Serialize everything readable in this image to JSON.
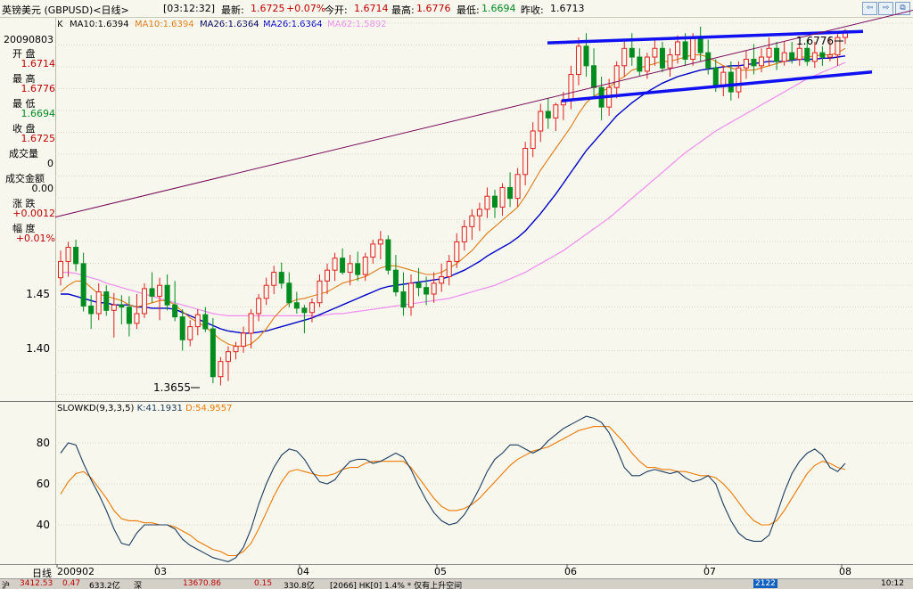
{
  "header": {
    "title": "英镑美元 (GBPUSD)<日线>",
    "time": "[03:12:32]",
    "latest_label": "最新:",
    "latest": "1.6725",
    "change": "+0.07%",
    "open_label": "今开:",
    "open": "1.6714",
    "high_label": "最高:",
    "high": "1.6776",
    "low_label": "最低:",
    "low": "1.6694",
    "prev_label": "昨收:",
    "prev": "1.6713",
    "buttons": [
      "⇦",
      "⇨",
      "⧉"
    ]
  },
  "ma_legend": {
    "k": "K",
    "ma10a": "MA10:1.6394",
    "ma10b": "MA10:1.6394",
    "ma26a": "MA26:1.6364",
    "ma26b": "MA26:1.6364",
    "ma62": "MA62:1.5892"
  },
  "sidepanel": {
    "date": "20090803",
    "open_label": "开  盘",
    "open": "1.6714",
    "high_label": "最  高",
    "high": "1.6776",
    "low_label": "最  低",
    "low": "1.6694",
    "close_label": "收  盘",
    "close": "1.6725",
    "vol_label": "成交量",
    "vol": "0",
    "amount_label": "成交金额",
    "amount": "0.00",
    "chg_label": "涨  跌",
    "chg": "+0.0012",
    "pct_label": "幅  度",
    "pct": "+0.01%"
  },
  "oscillator": {
    "name": "SLOWKD(9,3,3,5)",
    "k": "K:41.1931",
    "d": "D:54.9557"
  },
  "xaxis": {
    "period_label": "日线",
    "labels": [
      "200902",
      "03",
      "04",
      "05",
      "06",
      "07",
      "08"
    ]
  },
  "annotations": {
    "max": "1.6776",
    "min": "1.3655"
  },
  "status": {
    "s1": "沪",
    "v1": "3412.53",
    "c1": "0.47",
    "a1": "633.2亿",
    "s2": "深",
    "v2": "13670.86",
    "c2": "0.15",
    "a2": "330.8亿",
    "msg": "[2066] HK[0] 1.4% * 仅有上升空间",
    "right": "2122",
    "time": "10:12"
  },
  "chart_data": {
    "type": "candlestick",
    "price_axis": {
      "ticks": [
        1.4,
        1.45
      ],
      "labels_shown": [
        "1.40",
        "1.45"
      ]
    },
    "osc_axis": {
      "ticks": [
        40,
        60,
        80
      ],
      "ylim": [
        20,
        95
      ]
    },
    "series_labels": [
      "K",
      "MA10",
      "MA26",
      "MA62"
    ],
    "colors": {
      "up": "#E0201E",
      "down": "#008C1E",
      "ma10": "#E07A10",
      "ma26": "#0000C8",
      "ma62": "#F08CF0",
      "trend": "#1010F0",
      "resistance": "#7A0A5A",
      "k": "#1C3C60",
      "d": "#F07800"
    },
    "ohlc": [
      [
        1.465,
        1.49,
        1.458,
        1.48
      ],
      [
        1.48,
        1.498,
        1.466,
        1.493
      ],
      [
        1.493,
        1.5,
        1.471,
        1.478
      ],
      [
        1.478,
        1.488,
        1.434,
        1.439
      ],
      [
        1.439,
        1.449,
        1.418,
        1.432
      ],
      [
        1.432,
        1.46,
        1.426,
        1.452
      ],
      [
        1.452,
        1.458,
        1.43,
        1.435
      ],
      [
        1.435,
        1.451,
        1.41,
        1.44
      ],
      [
        1.44,
        1.449,
        1.422,
        1.438
      ],
      [
        1.438,
        1.448,
        1.411,
        1.423
      ],
      [
        1.423,
        1.45,
        1.418,
        1.432
      ],
      [
        1.432,
        1.46,
        1.428,
        1.455
      ],
      [
        1.455,
        1.47,
        1.442,
        1.448
      ],
      [
        1.448,
        1.465,
        1.426,
        1.458
      ],
      [
        1.458,
        1.468,
        1.435,
        1.44
      ],
      [
        1.44,
        1.462,
        1.425,
        1.429
      ],
      [
        1.429,
        1.436,
        1.398,
        1.408
      ],
      [
        1.408,
        1.426,
        1.402,
        1.42
      ],
      [
        1.42,
        1.436,
        1.412,
        1.431
      ],
      [
        1.431,
        1.438,
        1.415,
        1.418
      ],
      [
        1.418,
        1.428,
        1.368,
        1.374
      ],
      [
        1.374,
        1.392,
        1.366,
        1.388
      ],
      [
        1.388,
        1.402,
        1.37,
        1.397
      ],
      [
        1.397,
        1.406,
        1.39,
        1.402
      ],
      [
        1.402,
        1.42,
        1.396,
        1.414
      ],
      [
        1.414,
        1.436,
        1.4,
        1.432
      ],
      [
        1.432,
        1.45,
        1.425,
        1.446
      ],
      [
        1.446,
        1.465,
        1.44,
        1.458
      ],
      [
        1.458,
        1.476,
        1.45,
        1.47
      ],
      [
        1.47,
        1.479,
        1.455,
        1.46
      ],
      [
        1.46,
        1.47,
        1.438,
        1.442
      ],
      [
        1.442,
        1.452,
        1.432,
        1.437
      ],
      [
        1.437,
        1.44,
        1.414,
        1.433
      ],
      [
        1.433,
        1.446,
        1.424,
        1.442
      ],
      [
        1.442,
        1.468,
        1.438,
        1.462
      ],
      [
        1.462,
        1.478,
        1.45,
        1.472
      ],
      [
        1.472,
        1.488,
        1.462,
        1.483
      ],
      [
        1.483,
        1.492,
        1.468,
        1.47
      ],
      [
        1.47,
        1.486,
        1.458,
        1.478
      ],
      [
        1.478,
        1.489,
        1.462,
        1.468
      ],
      [
        1.468,
        1.488,
        1.462,
        1.484
      ],
      [
        1.484,
        1.5,
        1.478,
        1.496
      ],
      [
        1.496,
        1.508,
        1.482,
        1.5
      ],
      [
        1.5,
        1.504,
        1.468,
        1.472
      ],
      [
        1.472,
        1.486,
        1.448,
        1.452
      ],
      [
        1.452,
        1.47,
        1.43,
        1.438
      ],
      [
        1.438,
        1.468,
        1.43,
        1.46
      ],
      [
        1.46,
        1.474,
        1.448,
        1.456
      ],
      [
        1.456,
        1.466,
        1.44,
        1.45
      ],
      [
        1.45,
        1.47,
        1.442,
        1.46
      ],
      [
        1.46,
        1.478,
        1.452,
        1.466
      ],
      [
        1.466,
        1.486,
        1.458,
        1.48
      ],
      [
        1.48,
        1.506,
        1.474,
        1.498
      ],
      [
        1.498,
        1.518,
        1.49,
        1.512
      ],
      [
        1.512,
        1.528,
        1.5,
        1.522
      ],
      [
        1.522,
        1.534,
        1.508,
        1.528
      ],
      [
        1.528,
        1.548,
        1.52,
        1.54
      ],
      [
        1.54,
        1.546,
        1.52,
        1.53
      ],
      [
        1.53,
        1.552,
        1.522,
        1.548
      ],
      [
        1.548,
        1.562,
        1.53,
        1.538
      ],
      [
        1.538,
        1.566,
        1.53,
        1.56
      ],
      [
        1.56,
        1.59,
        1.55,
        1.584
      ],
      [
        1.584,
        1.608,
        1.576,
        1.6
      ],
      [
        1.6,
        1.625,
        1.59,
        1.618
      ],
      [
        1.618,
        1.63,
        1.602,
        1.612
      ],
      [
        1.612,
        1.626,
        1.6,
        1.624
      ],
      [
        1.624,
        1.636,
        1.61,
        1.628
      ],
      [
        1.628,
        1.66,
        1.62,
        1.652
      ],
      [
        1.652,
        1.686,
        1.642,
        1.678
      ],
      [
        1.678,
        1.69,
        1.65,
        1.66
      ],
      [
        1.66,
        1.676,
        1.632,
        1.64
      ],
      [
        1.64,
        1.65,
        1.61,
        1.622
      ],
      [
        1.622,
        1.648,
        1.614,
        1.64
      ],
      [
        1.64,
        1.664,
        1.63,
        1.66
      ],
      [
        1.66,
        1.682,
        1.65,
        1.676
      ],
      [
        1.676,
        1.69,
        1.66,
        1.668
      ],
      [
        1.668,
        1.676,
        1.65,
        1.655
      ],
      [
        1.655,
        1.672,
        1.648,
        1.668
      ],
      [
        1.668,
        1.684,
        1.66,
        1.676
      ],
      [
        1.676,
        1.682,
        1.654,
        1.658
      ],
      [
        1.658,
        1.676,
        1.65,
        1.67
      ],
      [
        1.67,
        1.688,
        1.662,
        1.682
      ],
      [
        1.682,
        1.69,
        1.66,
        1.666
      ],
      [
        1.666,
        1.69,
        1.66,
        1.686
      ],
      [
        1.686,
        1.696,
        1.664,
        1.672
      ],
      [
        1.672,
        1.684,
        1.652,
        1.658
      ],
      [
        1.658,
        1.666,
        1.636,
        1.642
      ],
      [
        1.642,
        1.66,
        1.632,
        1.654
      ],
      [
        1.654,
        1.664,
        1.628,
        1.636
      ],
      [
        1.636,
        1.664,
        1.63,
        1.658
      ],
      [
        1.658,
        1.674,
        1.648,
        1.666
      ],
      [
        1.666,
        1.68,
        1.652,
        1.66
      ],
      [
        1.66,
        1.676,
        1.654,
        1.668
      ],
      [
        1.668,
        1.686,
        1.66,
        1.676
      ],
      [
        1.676,
        1.682,
        1.656,
        1.664
      ],
      [
        1.664,
        1.682,
        1.66,
        1.672
      ],
      [
        1.672,
        1.682,
        1.662,
        1.666
      ],
      [
        1.666,
        1.68,
        1.66,
        1.676
      ],
      [
        1.676,
        1.684,
        1.66,
        1.664
      ],
      [
        1.664,
        1.682,
        1.658,
        1.672
      ],
      [
        1.672,
        1.678,
        1.66,
        1.668
      ],
      [
        1.668,
        1.686,
        1.664,
        1.67
      ],
      [
        1.67,
        1.69,
        1.66,
        1.686
      ],
      [
        1.686,
        1.694,
        1.68,
        1.692
      ]
    ],
    "ma10": [
      1.452,
      1.458,
      1.462,
      1.462,
      1.456,
      1.45,
      1.448,
      1.446,
      1.444,
      1.44,
      1.438,
      1.44,
      1.442,
      1.444,
      1.444,
      1.44,
      1.434,
      1.428,
      1.424,
      1.42,
      1.414,
      1.408,
      1.404,
      1.402,
      1.402,
      1.404,
      1.41,
      1.418,
      1.428,
      1.436,
      1.442,
      1.445,
      1.446,
      1.448,
      1.45,
      1.452,
      1.456,
      1.46,
      1.462,
      1.464,
      1.466,
      1.47,
      1.474,
      1.476,
      1.476,
      1.474,
      1.472,
      1.47,
      1.468,
      1.468,
      1.47,
      1.474,
      1.478,
      1.484,
      1.49,
      1.498,
      1.506,
      1.512,
      1.518,
      1.524,
      1.53,
      1.54,
      1.552,
      1.564,
      1.574,
      1.584,
      1.594,
      1.604,
      1.616,
      1.626,
      1.632,
      1.636,
      1.64,
      1.646,
      1.65,
      1.656,
      1.658,
      1.66,
      1.662,
      1.664,
      1.664,
      1.666,
      1.668,
      1.67,
      1.67,
      1.668,
      1.664,
      1.66,
      1.658,
      1.656,
      1.656,
      1.656,
      1.658,
      1.66,
      1.662,
      1.664,
      1.666,
      1.668,
      1.668,
      1.669,
      1.67,
      1.67,
      1.672,
      1.676
    ],
    "ma26": [
      1.45,
      1.45,
      1.448,
      1.446,
      1.444,
      1.442,
      1.442,
      1.44,
      1.44,
      1.44,
      1.438,
      1.438,
      1.437,
      1.437,
      1.437,
      1.436,
      1.433,
      1.43,
      1.427,
      1.424,
      1.421,
      1.418,
      1.416,
      1.415,
      1.414,
      1.414,
      1.415,
      1.416,
      1.418,
      1.42,
      1.422,
      1.424,
      1.426,
      1.428,
      1.431,
      1.434,
      1.437,
      1.44,
      1.443,
      1.446,
      1.449,
      1.452,
      1.455,
      1.457,
      1.458,
      1.459,
      1.46,
      1.461,
      1.462,
      1.463,
      1.464,
      1.466,
      1.469,
      1.472,
      1.476,
      1.48,
      1.485,
      1.489,
      1.493,
      1.497,
      1.502,
      1.508,
      1.516,
      1.524,
      1.533,
      1.542,
      1.552,
      1.562,
      1.572,
      1.582,
      1.59,
      1.598,
      1.606,
      1.614,
      1.62,
      1.626,
      1.631,
      1.636,
      1.64,
      1.644,
      1.647,
      1.65,
      1.652,
      1.654,
      1.656,
      1.657,
      1.658,
      1.659,
      1.66,
      1.66,
      1.661,
      1.662,
      1.663,
      1.664,
      1.664,
      1.664,
      1.665,
      1.666,
      1.666,
      1.666,
      1.667,
      1.667,
      1.668,
      1.669
    ],
    "ma62": [
      1.47,
      1.47,
      1.469,
      1.467,
      1.465,
      1.463,
      1.46,
      1.458,
      1.456,
      1.454,
      1.452,
      1.45,
      1.448,
      1.446,
      1.444,
      1.442,
      1.44,
      1.438,
      1.436,
      1.434,
      1.432,
      1.431,
      1.43,
      1.43,
      1.43,
      1.43,
      1.43,
      1.43,
      1.43,
      1.43,
      1.43,
      1.43,
      1.43,
      1.43,
      1.43,
      1.431,
      1.432,
      1.432,
      1.433,
      1.434,
      1.435,
      1.436,
      1.437,
      1.438,
      1.439,
      1.44,
      1.441,
      1.442,
      1.443,
      1.444,
      1.445,
      1.446,
      1.448,
      1.45,
      1.452,
      1.454,
      1.456,
      1.458,
      1.461,
      1.464,
      1.467,
      1.47,
      1.474,
      1.478,
      1.482,
      1.486,
      1.49,
      1.495,
      1.5,
      1.505,
      1.51,
      1.515,
      1.52,
      1.526,
      1.532,
      1.538,
      1.544,
      1.55,
      1.556,
      1.562,
      1.568,
      1.574,
      1.58,
      1.585,
      1.59,
      1.595,
      1.6,
      1.604,
      1.608,
      1.612,
      1.616,
      1.62,
      1.624,
      1.628,
      1.632,
      1.636,
      1.64,
      1.644,
      1.648,
      1.651,
      1.654,
      1.657,
      1.66,
      1.663
    ],
    "trendlines": [
      {
        "name": "upper",
        "from": [
          60,
          1.68
        ],
        "to": [
          103,
          1.691
        ]
      },
      {
        "name": "lower",
        "from": [
          60,
          1.624
        ],
        "to": [
          103,
          1.652
        ]
      },
      {
        "name": "middle",
        "from": [
          69,
          1.64
        ],
        "to": [
          91,
          1.667
        ]
      },
      {
        "name": "resistance",
        "from": [
          0,
          1.522
        ],
        "to": [
          103,
          1.696
        ]
      }
    ],
    "k": [
      75,
      80,
      79,
      70,
      62,
      55,
      47,
      38,
      31,
      30,
      36,
      40,
      40,
      40,
      40,
      38,
      33,
      30,
      28,
      26,
      24,
      23,
      22,
      24,
      29,
      38,
      50,
      60,
      68,
      74,
      77,
      76,
      72,
      66,
      61,
      60,
      62,
      67,
      71,
      72,
      72,
      70,
      71,
      73,
      75,
      73,
      67,
      59,
      52,
      46,
      42,
      40,
      41,
      45,
      51,
      58,
      66,
      72,
      75,
      79,
      79,
      77,
      75,
      77,
      81,
      84,
      87,
      89,
      91,
      93,
      92,
      90,
      85,
      77,
      68,
      64,
      64,
      66,
      67,
      66,
      65,
      66,
      63,
      61,
      62,
      64,
      60,
      50,
      42,
      36,
      33,
      32,
      32,
      35,
      45,
      56,
      65,
      71,
      75,
      77,
      74,
      68,
      66,
      70
    ],
    "d": [
      55,
      61,
      65,
      66,
      63,
      58,
      53,
      47,
      43,
      42,
      42,
      41,
      41,
      40,
      40,
      39,
      37,
      35,
      32,
      30,
      28,
      27,
      25,
      25,
      27,
      31,
      38,
      46,
      54,
      61,
      66,
      67,
      66,
      65,
      64,
      64,
      65,
      67,
      68,
      68,
      70,
      71,
      71,
      71,
      71,
      71,
      68,
      63,
      58,
      53,
      49,
      47,
      47,
      48,
      50,
      53,
      57,
      61,
      65,
      69,
      72,
      74,
      76,
      77,
      78,
      80,
      82,
      84,
      86,
      87,
      88,
      88,
      88,
      84,
      80,
      75,
      71,
      68,
      68,
      67,
      67,
      66,
      66,
      65,
      64,
      64,
      63,
      60,
      56,
      51,
      46,
      42,
      40,
      40,
      42,
      47,
      53,
      59,
      65,
      69,
      71,
      70,
      68,
      67
    ]
  }
}
